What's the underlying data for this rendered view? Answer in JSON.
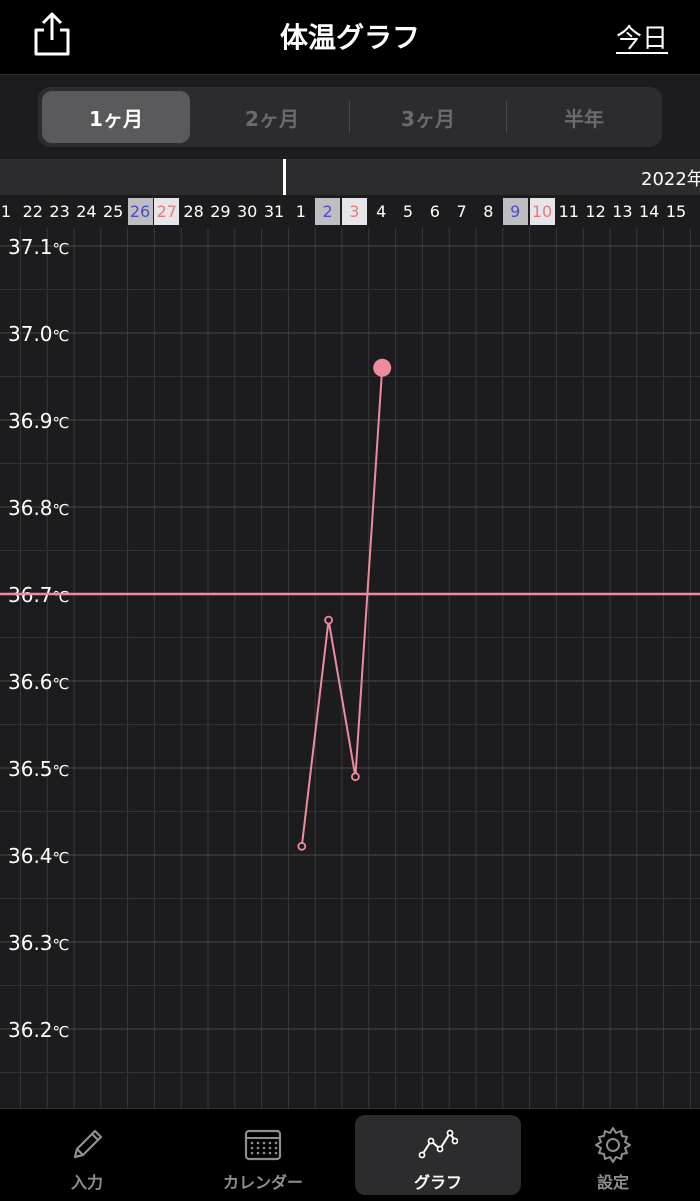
{
  "header": {
    "title": "体温グラフ",
    "today_label": "今日"
  },
  "period_tabs": [
    {
      "label": "1ヶ月",
      "active": true
    },
    {
      "label": "2ヶ月",
      "active": false
    },
    {
      "label": "3ヶ月",
      "active": false
    },
    {
      "label": "半年",
      "active": false
    }
  ],
  "timeline": {
    "year_label": "2022年"
  },
  "dates": [
    {
      "label": "1",
      "type": "normal"
    },
    {
      "label": "22",
      "type": "normal"
    },
    {
      "label": "23",
      "type": "normal"
    },
    {
      "label": "24",
      "type": "normal"
    },
    {
      "label": "25",
      "type": "normal"
    },
    {
      "label": "26",
      "type": "sat"
    },
    {
      "label": "27",
      "type": "sun"
    },
    {
      "label": "28",
      "type": "normal"
    },
    {
      "label": "29",
      "type": "normal"
    },
    {
      "label": "30",
      "type": "normal"
    },
    {
      "label": "31",
      "type": "normal"
    },
    {
      "label": "1",
      "type": "normal"
    },
    {
      "label": "2",
      "type": "sat"
    },
    {
      "label": "3",
      "type": "sun"
    },
    {
      "label": "4",
      "type": "normal"
    },
    {
      "label": "5",
      "type": "normal"
    },
    {
      "label": "6",
      "type": "normal"
    },
    {
      "label": "7",
      "type": "normal"
    },
    {
      "label": "8",
      "type": "normal"
    },
    {
      "label": "9",
      "type": "sat"
    },
    {
      "label": "10",
      "type": "sun"
    },
    {
      "label": "11",
      "type": "normal"
    },
    {
      "label": "12",
      "type": "normal"
    },
    {
      "label": "13",
      "type": "normal"
    },
    {
      "label": "14",
      "type": "normal"
    },
    {
      "label": "15",
      "type": "normal"
    }
  ],
  "chart_data": {
    "type": "line",
    "y_tick_labels": [
      "37.1℃",
      "37.0℃",
      "36.9℃",
      "36.8℃",
      "36.7℃",
      "36.6℃",
      "36.5℃",
      "36.4℃",
      "36.3℃",
      "36.2℃"
    ],
    "ylim": [
      36.1,
      37.1
    ],
    "reference_line": 36.7,
    "series": [
      {
        "points": [
          {
            "date": "1",
            "value": 36.41
          },
          {
            "date": "2",
            "value": 36.67
          },
          {
            "date": "3",
            "value": 36.49
          },
          {
            "date": "4",
            "value": 36.96
          }
        ]
      }
    ],
    "line_color": "#f08aa0",
    "reference_color": "#f08aa0",
    "grid": true
  },
  "tabbar": {
    "items": [
      {
        "label": "入力",
        "icon": "pencil-icon",
        "active": false
      },
      {
        "label": "カレンダー",
        "icon": "calendar-icon",
        "active": false
      },
      {
        "label": "グラフ",
        "icon": "graph-icon",
        "active": true
      },
      {
        "label": "設定",
        "icon": "gear-icon",
        "active": false
      }
    ]
  }
}
